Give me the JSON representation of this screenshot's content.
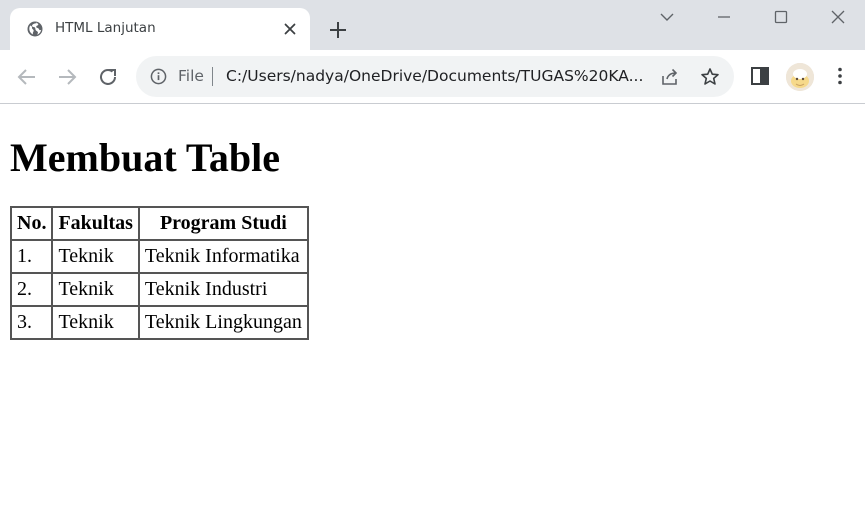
{
  "browser": {
    "tab_title": "HTML Lanjutan",
    "scheme_label": "File",
    "url": "C:/Users/nadya/OneDrive/Documents/TUGAS%20KA..."
  },
  "page": {
    "heading": "Membuat Table",
    "table": {
      "headers": [
        "No.",
        "Fakultas",
        "Program Studi"
      ],
      "rows": [
        [
          "1.",
          "Teknik",
          "Teknik Informatika"
        ],
        [
          "2.",
          "Teknik",
          "Teknik Industri"
        ],
        [
          "3.",
          "Teknik",
          "Teknik Lingkungan"
        ]
      ]
    }
  },
  "icons": {
    "favicon": "globe-icon",
    "tab_close": "close-icon",
    "new_tab": "plus-icon",
    "tab_search": "chevron-down-icon",
    "minimize": "minimize-icon",
    "maximize": "maximize-icon",
    "close_window": "close-icon",
    "back": "arrow-left-icon",
    "forward": "arrow-right-icon",
    "reload": "reload-icon",
    "site_info": "info-icon",
    "share": "share-icon",
    "bookmark": "star-icon",
    "side_panel": "side-panel-icon",
    "profile": "avatar",
    "menu": "kebab-menu-icon"
  },
  "colors": {
    "tabstrip_bg": "#dee1e6",
    "omnibox_bg": "#f1f3f4",
    "icon_color": "#5f6368"
  }
}
